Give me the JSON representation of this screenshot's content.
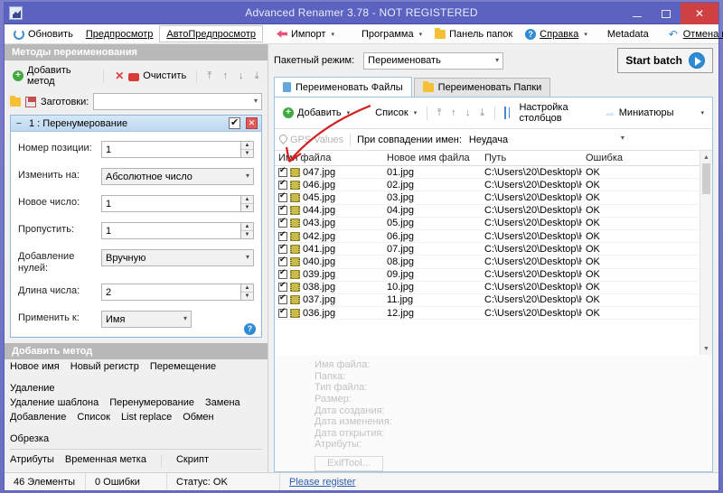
{
  "window": {
    "title": "Advanced Renamer 3.78 - NOT REGISTERED",
    "minimize": "–",
    "maximize": "□",
    "close": "✕"
  },
  "toolbar": {
    "items": [
      {
        "label": "Обновить",
        "icon": "refresh-icon",
        "caret": false,
        "boxed": false
      },
      {
        "label": "Предпросмотр",
        "icon": "",
        "caret": false,
        "boxed": false
      },
      {
        "label": "АвтоПредпросмотр",
        "icon": "",
        "caret": false,
        "boxed": true
      },
      {
        "label": "Импорт",
        "icon": "import-icon",
        "caret": true,
        "boxed": false
      },
      {
        "label": "Программа",
        "icon": "program-icon",
        "caret": true,
        "boxed": false
      },
      {
        "label": "Панель папок",
        "icon": "folder-icon",
        "caret": false,
        "boxed": false
      },
      {
        "label": "Справка",
        "icon": "help-icon",
        "caret": true,
        "boxed": false
      },
      {
        "label": "Metadata",
        "icon": "",
        "caret": false,
        "boxed": false
      },
      {
        "label": "Отмена изменений...",
        "icon": "undo-icon",
        "caret": false,
        "boxed": false
      }
    ],
    "help_glyph": "?",
    "undo_glyph": "↶"
  },
  "left_panel": {
    "header": "Методы переименования",
    "add_method_button": "Добавить метод",
    "clear_button": "Очистить",
    "move_buttons": [
      "⤒",
      "↑",
      "↓",
      "⤓"
    ],
    "presets_label": "Заготовки:",
    "presets_value": "",
    "method_card": {
      "collapse_glyph": "−",
      "title": "1 : Перенумерование",
      "enabled": true,
      "close_glyph": "✕",
      "help_glyph": "?",
      "fields": [
        {
          "label": "Номер позиции:",
          "type": "spin",
          "value": "1"
        },
        {
          "label": "Изменить на:",
          "type": "combo",
          "value": "Абсолютное число"
        },
        {
          "label": "Новое число:",
          "type": "spin",
          "value": "1"
        },
        {
          "label": "Пропустить:",
          "type": "spin",
          "value": "1"
        },
        {
          "label": "Добавление нулей:",
          "type": "combo",
          "value": "Вручную"
        },
        {
          "label": "Длина числа:",
          "type": "spin",
          "value": "2"
        },
        {
          "label": "Применить к:",
          "type": "combo-short",
          "value": "Имя"
        }
      ]
    },
    "add_section": {
      "header": "Добавить метод",
      "row1": [
        "Новое имя",
        "Новый регистр",
        "Перемещение",
        "Удаление"
      ],
      "row2": [
        "Удаление шаблона",
        "Перенумерование",
        "Замена"
      ],
      "row3": [
        "Добавление",
        "Список",
        "List replace",
        "Обмен",
        "Обрезка"
      ],
      "row4": [
        "Атрибуты",
        "Временная метка",
        "Скрипт"
      ]
    }
  },
  "right_panel": {
    "batch_mode_label": "Пакетный режим:",
    "batch_mode_value": "Переименовать",
    "start_batch_label": "Start batch",
    "tabs": [
      {
        "label": "Переименовать Файлы",
        "active": true,
        "icon": "file-icon"
      },
      {
        "label": "Переименовать Папки",
        "active": false,
        "icon": "folder-icon"
      }
    ],
    "list_toolbar": {
      "add_label": "Добавить",
      "list_label": "Список",
      "move_buttons": [
        "⤒",
        "↑",
        "↓",
        "⤓"
      ],
      "columns_label": "Настройка столбцов",
      "thumbnails_label": "Миниатюры"
    },
    "gps_label": "GPS Values",
    "collision_label": "При совпадении имен:",
    "collision_value": "Неудача",
    "grid": {
      "columns": [
        "Имя файла",
        "Новое имя файла",
        "Путь",
        "Ошибка"
      ],
      "rows": [
        {
          "checked": true,
          "name": "047.jpg",
          "newname": "01.jpg",
          "path": "C:\\Users\\20\\Desktop\\H...",
          "error": "OK"
        },
        {
          "checked": true,
          "name": "046.jpg",
          "newname": "02.jpg",
          "path": "C:\\Users\\20\\Desktop\\H...",
          "error": "OK"
        },
        {
          "checked": true,
          "name": "045.jpg",
          "newname": "03.jpg",
          "path": "C:\\Users\\20\\Desktop\\H...",
          "error": "OK"
        },
        {
          "checked": true,
          "name": "044.jpg",
          "newname": "04.jpg",
          "path": "C:\\Users\\20\\Desktop\\H...",
          "error": "OK"
        },
        {
          "checked": true,
          "name": "043.jpg",
          "newname": "05.jpg",
          "path": "C:\\Users\\20\\Desktop\\H...",
          "error": "OK"
        },
        {
          "checked": true,
          "name": "042.jpg",
          "newname": "06.jpg",
          "path": "C:\\Users\\20\\Desktop\\H...",
          "error": "OK"
        },
        {
          "checked": true,
          "name": "041.jpg",
          "newname": "07.jpg",
          "path": "C:\\Users\\20\\Desktop\\H...",
          "error": "OK"
        },
        {
          "checked": true,
          "name": "040.jpg",
          "newname": "08.jpg",
          "path": "C:\\Users\\20\\Desktop\\H...",
          "error": "OK"
        },
        {
          "checked": true,
          "name": "039.jpg",
          "newname": "09.jpg",
          "path": "C:\\Users\\20\\Desktop\\H...",
          "error": "OK"
        },
        {
          "checked": true,
          "name": "038.jpg",
          "newname": "10.jpg",
          "path": "C:\\Users\\20\\Desktop\\H...",
          "error": "OK"
        },
        {
          "checked": true,
          "name": "037.jpg",
          "newname": "11.jpg",
          "path": "C:\\Users\\20\\Desktop\\H...",
          "error": "OK"
        },
        {
          "checked": true,
          "name": "036.jpg",
          "newname": "12.jpg",
          "path": "C:\\Users\\20\\Desktop\\H...",
          "error": "OK"
        }
      ]
    },
    "properties": {
      "labels": [
        "Имя файла:",
        "Папка:",
        "Тип файла:",
        "Размер:",
        "Дата создания:",
        "Дата изменения:",
        "Дата открытия:",
        "Атрибуты:"
      ],
      "exif_button": "ExifTool..."
    }
  },
  "status_bar": {
    "items_count": "46 Элементы",
    "errors_count": "0 Ошибки",
    "status": "Статус: OK",
    "register_link": "Please register"
  },
  "colors": {
    "titlebar": "#5b62c0",
    "close_button": "#cf4042",
    "accent_blue": "#2e8bd6",
    "annotation_red": "#d21f1f",
    "tab_active": "#ffffff"
  }
}
